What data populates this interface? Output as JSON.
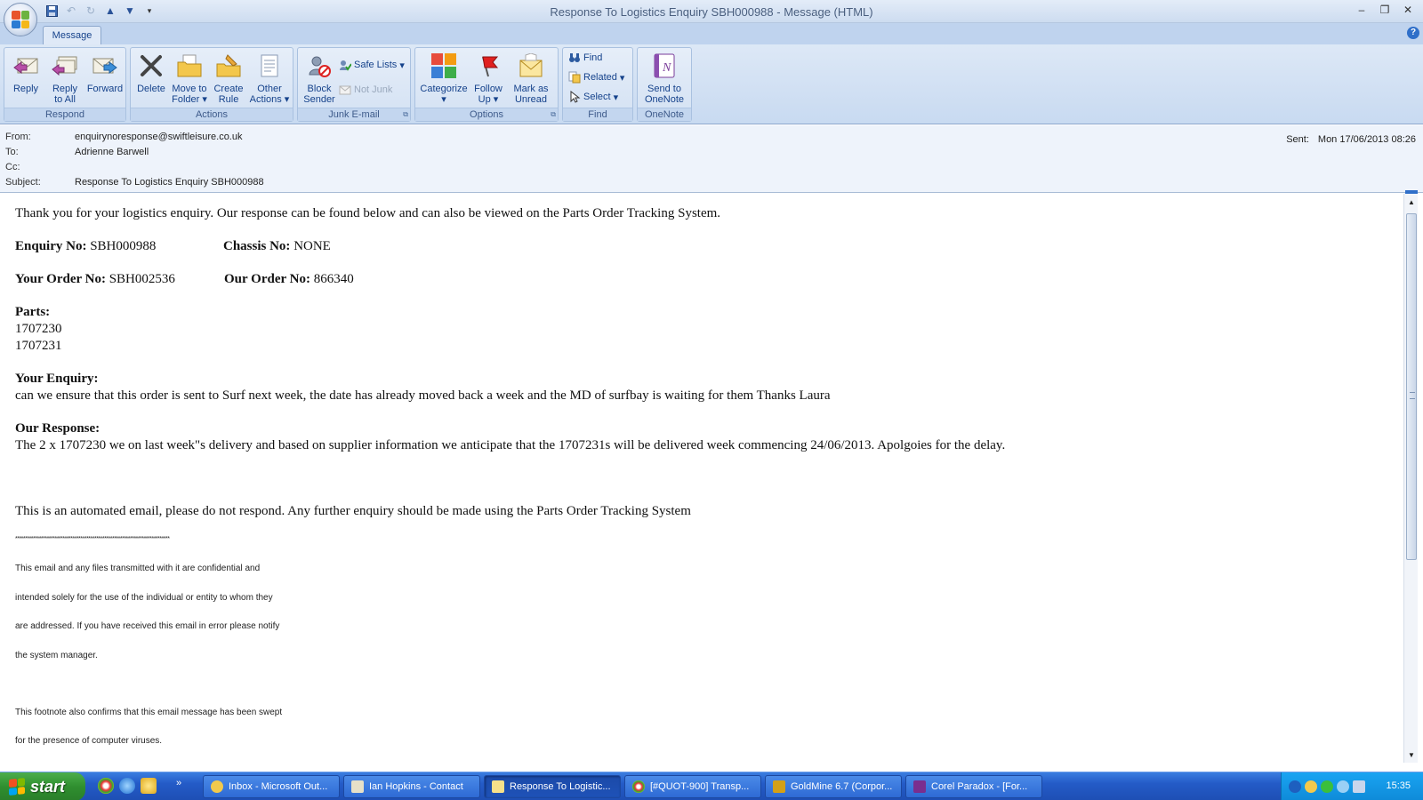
{
  "window": {
    "title": "Response To Logistics Enquiry SBH000988 - Message (HTML)"
  },
  "ribbon": {
    "tab": "Message",
    "groups": {
      "respond": {
        "label": "Respond",
        "reply": "Reply",
        "reply_all_1": "Reply",
        "reply_all_2": "to All",
        "forward": "Forward"
      },
      "actions": {
        "label": "Actions",
        "delete": "Delete",
        "move_1": "Move to",
        "move_2": "Folder",
        "create_1": "Create",
        "create_2": "Rule",
        "other_1": "Other",
        "other_2": "Actions"
      },
      "junk": {
        "label": "Junk E-mail",
        "block_1": "Block",
        "block_2": "Sender",
        "safe_lists": "Safe Lists",
        "not_junk": "Not Junk"
      },
      "options": {
        "label": "Options",
        "categorize": "Categorize",
        "follow_1": "Follow",
        "follow_2": "Up",
        "mark_1": "Mark as",
        "mark_2": "Unread"
      },
      "find": {
        "label": "Find",
        "find": "Find",
        "related": "Related",
        "select": "Select"
      },
      "onenote": {
        "label": "OneNote",
        "send_1": "Send to",
        "send_2": "OneNote"
      }
    }
  },
  "header": {
    "from_label": "From:",
    "from": "enquirynoresponse@swiftleisure.co.uk",
    "to_label": "To:",
    "to": "Adrienne Barwell",
    "cc_label": "Cc:",
    "cc": "",
    "subject_label": "Subject:",
    "subject": "Response To Logistics Enquiry SBH000988",
    "sent_label": "Sent:",
    "sent": "Mon 17/06/2013 08:26"
  },
  "body": {
    "intro": "Thank you for your logistics enquiry. Our response can be found below and can also be viewed on the Parts Order Tracking System.",
    "enquiry_no_label": "Enquiry No:",
    "enquiry_no": "SBH000988",
    "chassis_no_label": "Chassis No:",
    "chassis_no": "NONE",
    "your_order_label": "Your Order No:",
    "your_order": "SBH002536",
    "our_order_label": "Our Order No:",
    "our_order": "866340",
    "parts_label": "Parts:",
    "parts": [
      "1707230",
      "1707231"
    ],
    "your_enquiry_label": "Your Enquiry:",
    "your_enquiry": "can we ensure that this order is sent to Surf next week, the date has already moved back a week and the MD of surfbay is waiting for them Thanks Laura",
    "our_response_label": "Our Response:",
    "our_response": "The 2 x 1707230 we on last week\"s delivery and based on supplier information we anticipate that the 1707231s will be delivered week commencing 24/06/2013. Apolgoies for the delay.",
    "automated": "This is an automated email, please do not respond. Any further enquiry should be made using the Parts Order Tracking System",
    "stars": "******************************************************************************",
    "disclaimer": [
      "This email and any files transmitted with it are confidential and",
      "intended solely for the use of the individual or entity to whom they",
      "are addressed. If you have received this email in error please notify",
      "the system manager.",
      "This footnote also confirms that this email message has been swept",
      "for the presence of computer viruses."
    ]
  },
  "taskbar": {
    "start": "start",
    "tasks": [
      "Inbox - Microsoft Out...",
      "Ian Hopkins - Contact",
      "Response To Logistic...",
      "[#QUOT-900] Transp...",
      "GoldMine 6.7 (Corpor...",
      "Corel Paradox - [For..."
    ],
    "clock": "15:35"
  },
  "colors": {
    "ribbon_bg": "#c8daf1",
    "ribbon_text": "#15428b",
    "taskbar": "#245bc7",
    "start": "#2f8f2f"
  }
}
